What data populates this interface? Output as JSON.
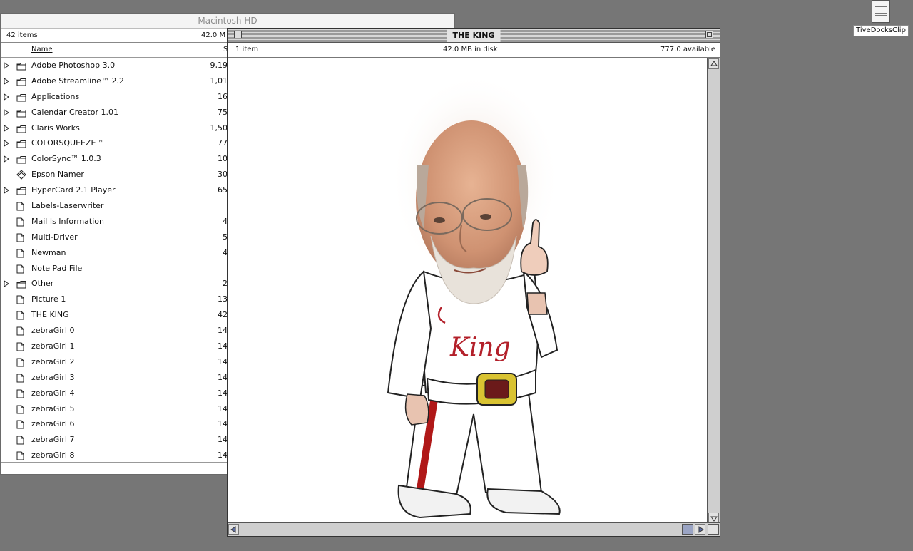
{
  "desktop": {
    "icon_label": "TiveDocksClip"
  },
  "back_window": {
    "title": "Macintosh HD",
    "item_count": "42 items",
    "disk_info": "42.0 M",
    "col_name": "Name",
    "col_size": "S",
    "items": [
      {
        "name": "Adobe Photoshop 3.0",
        "size": "9,19",
        "type": "folder",
        "expandable": true
      },
      {
        "name": "Adobe Streamline™ 2.2",
        "size": "1,01",
        "type": "folder",
        "expandable": true
      },
      {
        "name": "Applications",
        "size": "16",
        "type": "folder",
        "expandable": true
      },
      {
        "name": "Calendar Creator 1.01",
        "size": "75",
        "type": "folder",
        "expandable": true
      },
      {
        "name": "Claris Works",
        "size": "1,50",
        "type": "folder",
        "expandable": true
      },
      {
        "name": "COLORSQUEEZE™",
        "size": "77",
        "type": "folder",
        "expandable": true
      },
      {
        "name": "ColorSync™ 1.0.3",
        "size": "10",
        "type": "folder",
        "expandable": true
      },
      {
        "name": "Epson Namer",
        "size": "30",
        "type": "app",
        "expandable": false
      },
      {
        "name": "HyperCard 2.1 Player",
        "size": "65",
        "type": "folder",
        "expandable": true
      },
      {
        "name": "Labels-Laserwriter",
        "size": "",
        "type": "doc",
        "expandable": false
      },
      {
        "name": "Mail Is Information",
        "size": "4",
        "type": "doc",
        "expandable": false
      },
      {
        "name": "Multi-Driver",
        "size": "5",
        "type": "doc",
        "expandable": false
      },
      {
        "name": "Newman",
        "size": "4",
        "type": "doc",
        "expandable": false
      },
      {
        "name": "Note Pad File",
        "size": "",
        "type": "doc",
        "expandable": false
      },
      {
        "name": "Other",
        "size": "2",
        "type": "folder",
        "expandable": true
      },
      {
        "name": "Picture 1",
        "size": "13",
        "type": "doc",
        "expandable": false
      },
      {
        "name": "THE KING",
        "size": "42",
        "type": "doc",
        "expandable": false
      },
      {
        "name": "zebraGirl 0",
        "size": "14",
        "type": "doc",
        "expandable": false
      },
      {
        "name": "zebraGirl 1",
        "size": "14",
        "type": "doc",
        "expandable": false
      },
      {
        "name": "zebraGirl 2",
        "size": "14",
        "type": "doc",
        "expandable": false
      },
      {
        "name": "zebraGirl 3",
        "size": "14",
        "type": "doc",
        "expandable": false
      },
      {
        "name": "zebraGirl 4",
        "size": "14",
        "type": "doc",
        "expandable": false
      },
      {
        "name": "zebraGirl 5",
        "size": "14",
        "type": "doc",
        "expandable": false
      },
      {
        "name": "zebraGirl 6",
        "size": "14",
        "type": "doc",
        "expandable": false
      },
      {
        "name": "zebraGirl 7",
        "size": "14",
        "type": "doc",
        "expandable": false
      },
      {
        "name": "zebraGirl 8",
        "size": "14",
        "type": "doc",
        "expandable": false
      }
    ]
  },
  "front_window": {
    "title": "THE KING",
    "item_count": "1 item",
    "disk_info": "42.0 MB in disk",
    "available": "777.0 available",
    "image_text": "King"
  },
  "colors": {
    "desktop": "#767676",
    "suit": "#ffffff",
    "stripe": "#b01818",
    "belt_buckle": "#d9c332",
    "lettering": "#b3202a"
  }
}
